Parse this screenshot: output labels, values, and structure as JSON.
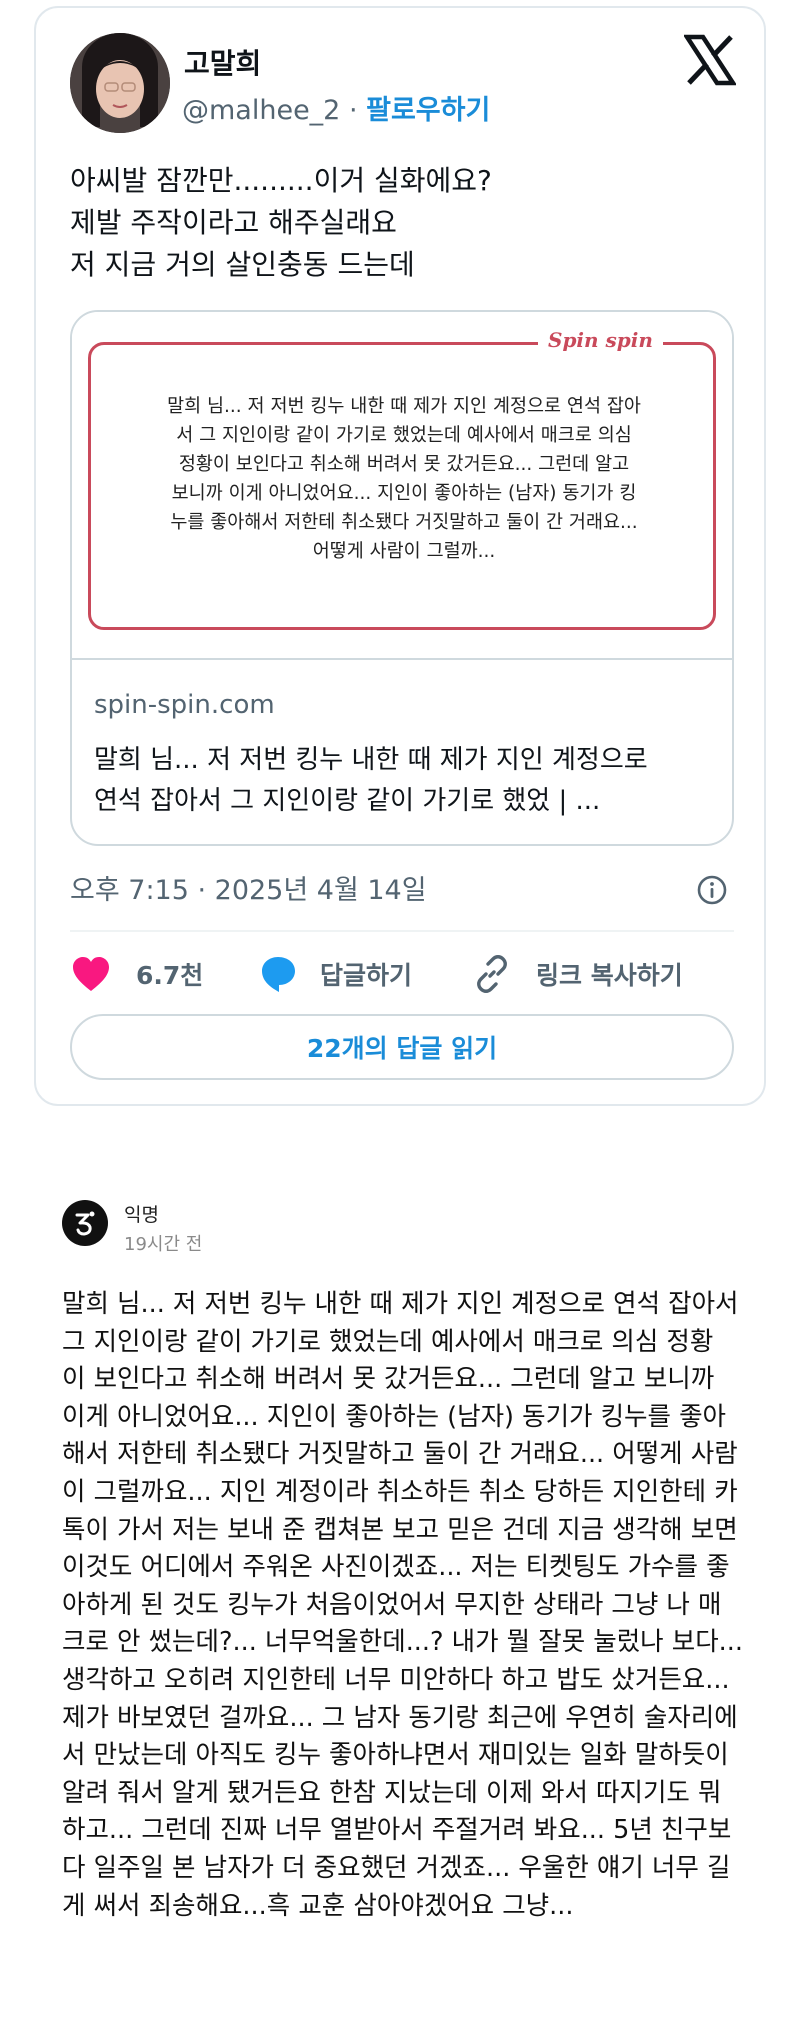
{
  "tweet": {
    "author_name": "고말희",
    "author_handle": "@malhee_2",
    "separator": " · ",
    "follow_label": "팔로우하기",
    "text_lines": [
      "아씨발 잠깐만.........이거 실화에요?",
      "제발 주작이라고 해주실래요",
      "저 지금 거의 살인충동 드는데"
    ],
    "link_card": {
      "logo_text": "Spin spin",
      "preview_lines": [
        "말희 님... 저 저번 킹누 내한 때 제가 지인 계정으로 연석 잡아",
        "서 그 지인이랑 같이 가기로 했었는데 예사에서 매크로 의심",
        "정황이 보인다고 취소해 버려서 못 갔거든요... 그런데 알고",
        "보니까 이게 아니었어요... 지인이 좋아하는 (남자) 동기가 킹",
        "누를 좋아해서 저한테 취소됐다 거짓말하고 둘이 간 거래요...",
        "어떻게 사람이 그럴까..."
      ],
      "domain": "spin-spin.com",
      "title_lines": [
        "말희 님... 저 저번 킹누 내한 때 제가 지인 계정으로",
        "연석 잡아서 그 지인이랑 같이 가기로 했었 | ..."
      ]
    },
    "timestamp": "오후 7:15 · 2025년 4월 14일",
    "like_count": "6.7천",
    "reply_label": "답글하기",
    "copy_link_label": "링크 복사하기",
    "read_replies_label": "22개의 답글 읽기",
    "colors": {
      "like": "#f91880",
      "reply": "#1d9bf0",
      "link": "#1a8cd8",
      "brand": "#c94a5b"
    }
  },
  "post": {
    "author": "익명",
    "time": "19시간 전",
    "lines": [
      "말희 님... 저 저번 킹누 내한 때 제가 지인 계정으로 연석 잡아서",
      "그 지인이랑 같이 가기로 했었는데 예사에서 매크로 의심 정황",
      "이 보인다고 취소해 버려서 못 갔거든요... 그런데 알고 보니까",
      "이게 아니었어요... 지인이 좋아하는 (남자) 동기가 킹누를 좋아",
      "해서 저한테 취소됐다 거짓말하고 둘이 간 거래요... 어떻게 사람",
      "이 그럴까요... 지인 계정이라 취소하든 취소 당하든 지인한테 카",
      "톡이 가서 저는 보내 준 캡쳐본 보고 믿은 건데 지금 생각해 보면",
      "이것도 어디에서 주워온 사진이겠죠... 저는 티켓팅도 가수를 좋",
      "아하게 된 것도 킹누가 처음이었어서 무지한 상태라 그냥 나 매",
      "크로 안 썼는데?... 너무억울한데...? 내가 뭘 잘못 눌렀나 보다...",
      "생각하고 오히려 지인한테 너무 미안하다 하고 밥도 샀거든요...",
      "제가 바보였던 걸까요... 그 남자 동기랑 최근에 우연히 술자리에",
      "서 만났는데 아직도 킹누 좋아하냐면서 재미있는 일화 말하듯이",
      "알려 줘서 알게 됐거든요 한참 지났는데 이제 와서 따지기도 뭐",
      "하고... 그런데 진짜 너무 열받아서 주절거려 봐요... 5년 친구보",
      "다 일주일 본 남자가 더 중요했던 거겠죠... 우울한 얘기 너무 길",
      "게 써서 죄송해요...흑 교훈 삼아야겠어요 그냥..."
    ]
  }
}
